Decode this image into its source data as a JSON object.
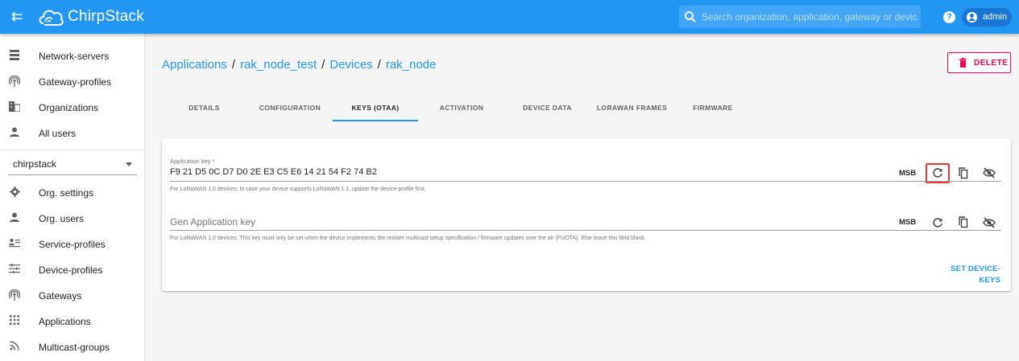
{
  "appbar": {
    "brand": "ChirpStack",
    "search_placeholder": "Search organization, application, gateway or device",
    "help": "?",
    "user": "admin"
  },
  "sidebar": {
    "global_items": [
      {
        "label": "Network-servers",
        "icon": "server-icon"
      },
      {
        "label": "Gateway-profiles",
        "icon": "radio-tower-icon"
      },
      {
        "label": "Organizations",
        "icon": "domain-icon"
      },
      {
        "label": "All users",
        "icon": "person-icon"
      }
    ],
    "organization": "chirpstack",
    "org_items": [
      {
        "label": "Org. settings",
        "icon": "gear-icon"
      },
      {
        "label": "Org. users",
        "icon": "person-icon"
      },
      {
        "label": "Service-profiles",
        "icon": "account-details-icon"
      },
      {
        "label": "Device-profiles",
        "icon": "tune-icon"
      },
      {
        "label": "Gateways",
        "icon": "radio-tower-icon"
      },
      {
        "label": "Applications",
        "icon": "apps-icon"
      },
      {
        "label": "Multicast-groups",
        "icon": "rss-icon"
      }
    ]
  },
  "breadcrumb": {
    "applications": "Applications",
    "app_name": "rak_node_test",
    "devices": "Devices",
    "device_name": "rak_node",
    "separator": "/"
  },
  "actions": {
    "delete": "DELETE"
  },
  "tabs": [
    {
      "label": "DETAILS",
      "active": false
    },
    {
      "label": "CONFIGURATION",
      "active": false
    },
    {
      "label": "KEYS (OTAA)",
      "active": true
    },
    {
      "label": "ACTIVATION",
      "active": false
    },
    {
      "label": "DEVICE DATA",
      "active": false
    },
    {
      "label": "LORAWAN FRAMES",
      "active": false
    },
    {
      "label": "FIRMWARE",
      "active": false
    }
  ],
  "keys_form": {
    "app_key": {
      "label": "Application key *",
      "value": "F9 21 D5 0C D7 D0 2E E3 C5 E6 14 21 54 F2 74 B2",
      "byte_order": "MSB",
      "helper": "For LoRaWAN 1.0 devices. In case your device supports LoRaWAN 1.1, update the device-profile first."
    },
    "gen_app_key": {
      "placeholder": "Gen Application key",
      "value": "",
      "byte_order": "MSB",
      "helper": "For LoRaWAN 1.0 devices. This key must only be set when the device implements the remote multicast setup specification / firmware updates over the air (FUOTA). Else leave this field blank."
    },
    "submit": "SET DEVICE-KEYS"
  },
  "colors": {
    "primary": "#2196f3",
    "accent": "#f50057",
    "highlight": "#e53935"
  }
}
